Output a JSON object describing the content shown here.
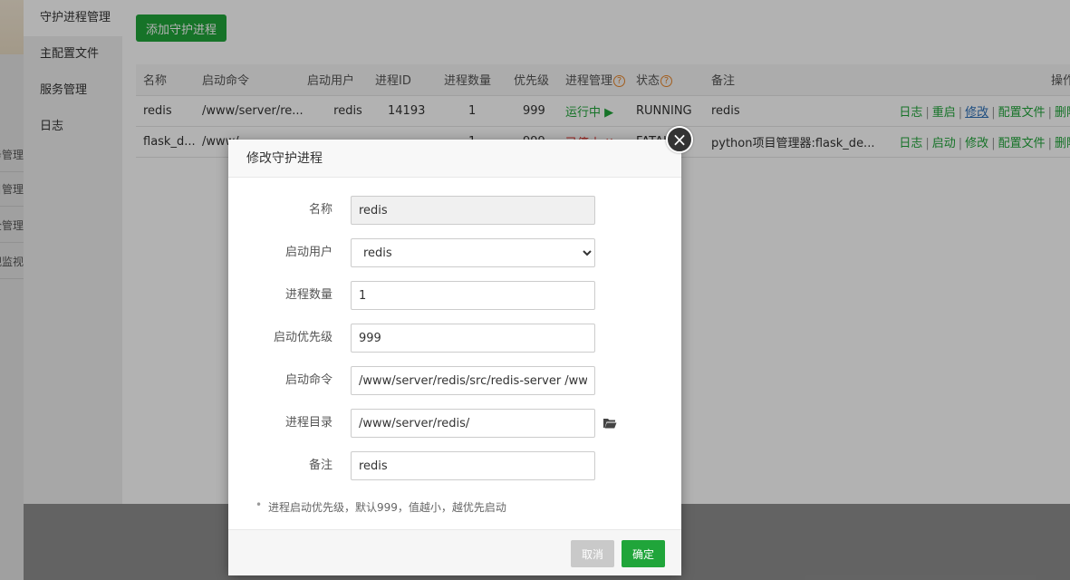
{
  "background": {
    "mini_nav": [
      "务管理",
      "目管理",
      "全管理",
      "视监视"
    ],
    "plugin_side": [
      "守护进程管理",
      "主配置文件",
      "服务管理",
      "日志"
    ],
    "add_button": "添加守护进程",
    "table": {
      "headers": [
        "名称",
        "启动命令",
        "启动用户",
        "进程ID",
        "进程数量",
        "优先级",
        "进程管理",
        "状态",
        "备注",
        "操作"
      ],
      "rows": [
        {
          "name": "redis",
          "command": "/www/server/re...",
          "user": "redis",
          "pid": "14193",
          "count": "1",
          "priority": "999",
          "manage": "运行中",
          "status": "RUNNING",
          "remark": "redis",
          "ops": [
            "日志",
            "重启",
            "修改",
            "配置文件",
            "删除"
          ]
        },
        {
          "name": "flask_d...",
          "command": "/www/...",
          "user": "",
          "pid": "",
          "count": "1",
          "priority": "999",
          "manage": "已停止",
          "status": "FATAL",
          "remark": "python项目管理器:flask_de...",
          "ops": [
            "日志",
            "启动",
            "修改",
            "配置文件",
            "删除"
          ]
        }
      ]
    }
  },
  "modal": {
    "title": "修改守护进程",
    "fields": {
      "name": {
        "label": "名称",
        "value": "redis"
      },
      "user": {
        "label": "启动用户",
        "value": "redis"
      },
      "count": {
        "label": "进程数量",
        "value": "1"
      },
      "priority": {
        "label": "启动优先级",
        "value": "999"
      },
      "command": {
        "label": "启动命令",
        "value": "/www/server/redis/src/redis-server /www/server/redis/redis.conf"
      },
      "directory": {
        "label": "进程目录",
        "value": "/www/server/redis/"
      },
      "remark": {
        "label": "备注",
        "value": "redis"
      }
    },
    "tip": "进程启动优先级，默认999，值越小，越优先启动",
    "cancel": "取消",
    "confirm": "确定",
    "close_glyph": "×"
  },
  "colors": {
    "accent": "#20a53a",
    "danger": "#e0322b",
    "warning": "#e8862a"
  }
}
